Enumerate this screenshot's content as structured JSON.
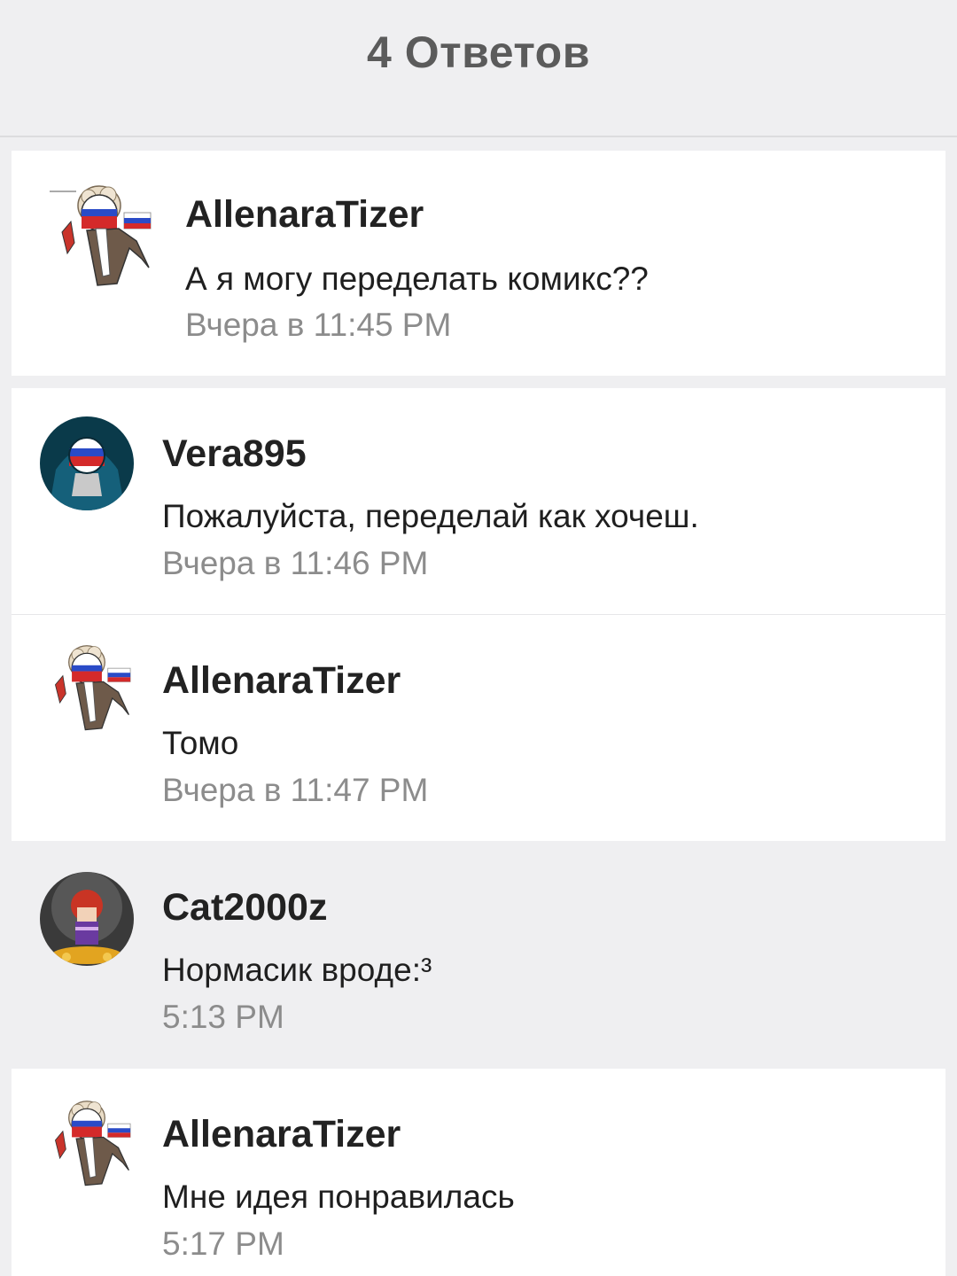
{
  "header": {
    "title": "4 Ответов"
  },
  "parent_comment": {
    "username": "AllenaraTizer",
    "message": "А я могу переделать комикс??",
    "time": "Вчера в 11:45 PM",
    "avatar": "countryhuman-russia-avatar"
  },
  "replies": [
    {
      "username": "Vera895",
      "message": "Пожалуйста, переделай как хочеш.",
      "time": "Вчера в 11:46 PM",
      "avatar": "hooded-russia-avatar"
    },
    {
      "username": "AllenaraTizer",
      "message": "Томо",
      "time": "Вчера в 11:47 PM",
      "avatar": "countryhuman-russia-avatar"
    },
    {
      "username": "Cat2000z",
      "message": "Нормасик вроде:³",
      "time": "5:13 PM",
      "avatar": "red-hair-character-avatar"
    },
    {
      "username": "AllenaraTizer",
      "message": "Мне идея понравилась",
      "time": "5:17 PM",
      "avatar": "countryhuman-russia-avatar"
    }
  ],
  "colors": {
    "background": "#efeff1",
    "card": "#ffffff",
    "username": "#222222",
    "timestamp": "#8c8c8c"
  }
}
